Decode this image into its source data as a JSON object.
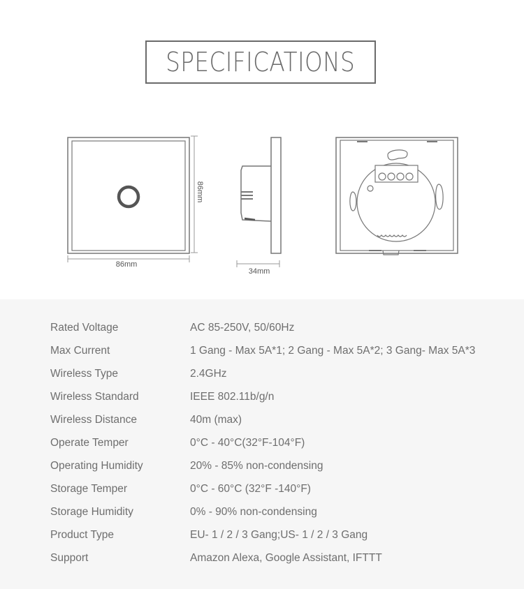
{
  "title": "SPECIFICATIONS",
  "diagrams": {
    "front": {
      "width_label": "86mm",
      "height_label": "86mm"
    },
    "side": {
      "depth_label": "34mm"
    },
    "back": {}
  },
  "colors": {
    "title_border": "#6a6a6a",
    "text": "#6e6e6e",
    "spec_background": "#f6f6f6"
  },
  "specs": [
    {
      "label": "Rated Voltage",
      "value": "AC 85-250V, 50/60Hz"
    },
    {
      "label": "Max Current",
      "value": "1 Gang - Max 5A*1; 2 Gang - Max 5A*2; 3 Gang- Max 5A*3"
    },
    {
      "label": "Wireless Type",
      "value": "2.4GHz"
    },
    {
      "label": "Wireless Standard",
      "value": "IEEE 802.11b/g/n"
    },
    {
      "label": "Wireless Distance",
      "value": "40m (max)"
    },
    {
      "label": "Operate Temper",
      "value": "0°C - 40°C(32°F-104°F)"
    },
    {
      "label": "Operating Humidity",
      "value": "20% - 85% non-condensing"
    },
    {
      "label": "Storage Temper",
      "value": "0°C - 60°C (32°F -140°F)"
    },
    {
      "label": "Storage Humidity",
      "value": "0% - 90% non-condensing"
    },
    {
      "label": "Product Type",
      "value": "EU- 1 / 2 / 3 Gang;US- 1 / 2 / 3 Gang"
    },
    {
      "label": "Support",
      "value": "Amazon Alexa, Google Assistant, IFTTT"
    }
  ]
}
